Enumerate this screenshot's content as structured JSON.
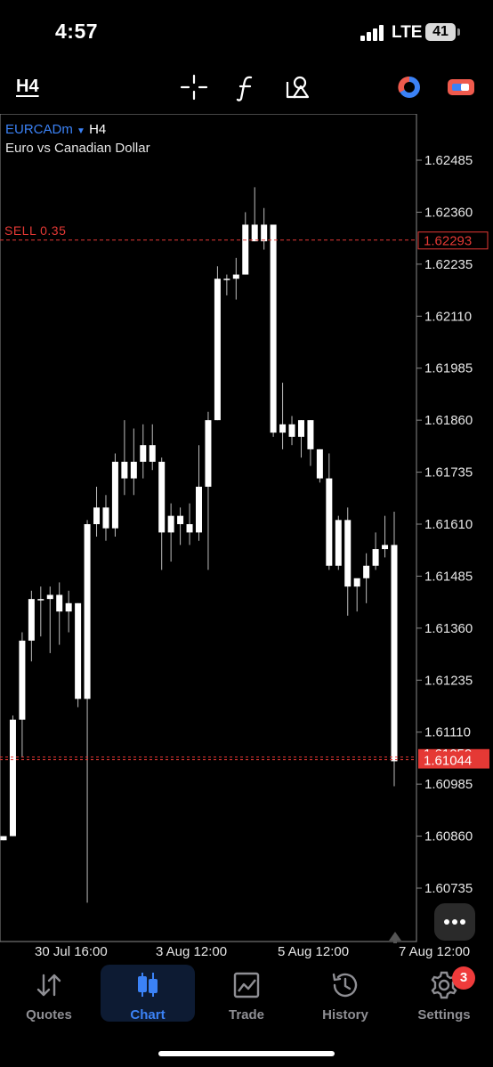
{
  "status": {
    "time": "4:57",
    "network": "LTE",
    "battery": "41"
  },
  "toolbar": {
    "timeframe": "H4"
  },
  "chart": {
    "symbol": "EURCADm",
    "timeframe": "H4",
    "description": "Euro vs Canadian Dollar",
    "sell_label": "SELL 0.35",
    "sell_price": "1.62293",
    "bid_price": "1.61044",
    "ask_price_partial": "1.61050",
    "colors": {
      "accent": "#3b82f6",
      "sell": "#e53935",
      "bid_bg": "#e53935",
      "candle": "#ffffff",
      "background": "#000000"
    }
  },
  "chart_data": {
    "type": "candlestick",
    "y_ticks": [
      "1.62485",
      "1.62360",
      "1.62235",
      "1.62110",
      "1.61985",
      "1.61860",
      "1.61735",
      "1.61610",
      "1.61485",
      "1.61360",
      "1.61235",
      "1.61110",
      "1.60985",
      "1.60860",
      "1.60735"
    ],
    "x_ticks": [
      "30 Jul 16:00",
      "3 Aug 12:00",
      "5 Aug 12:00",
      "7 Aug 12:00"
    ],
    "ylim": [
      1.6068,
      1.6255
    ],
    "candles": [
      [
        1.6085,
        1.6086,
        1.6085,
        1.6086
      ],
      [
        1.6086,
        1.6115,
        1.6086,
        1.6114
      ],
      [
        1.6114,
        1.6135,
        1.6105,
        1.6133
      ],
      [
        1.6133,
        1.6145,
        1.6128,
        1.6143
      ],
      [
        1.6143,
        1.6146,
        1.6134,
        1.6143
      ],
      [
        1.6143,
        1.6146,
        1.613,
        1.6144
      ],
      [
        1.6144,
        1.6147,
        1.6132,
        1.614
      ],
      [
        1.614,
        1.6145,
        1.6135,
        1.6142
      ],
      [
        1.6142,
        1.6142,
        1.6117,
        1.6119
      ],
      [
        1.6119,
        1.6162,
        1.607,
        1.6161
      ],
      [
        1.6161,
        1.617,
        1.6158,
        1.6165
      ],
      [
        1.6165,
        1.6168,
        1.6157,
        1.616
      ],
      [
        1.616,
        1.6178,
        1.6158,
        1.6176
      ],
      [
        1.6176,
        1.6186,
        1.6168,
        1.6172
      ],
      [
        1.6172,
        1.6184,
        1.6168,
        1.6176
      ],
      [
        1.6176,
        1.6185,
        1.6172,
        1.618
      ],
      [
        1.618,
        1.6185,
        1.6174,
        1.6176
      ],
      [
        1.6176,
        1.6177,
        1.615,
        1.6159
      ],
      [
        1.6159,
        1.6166,
        1.6152,
        1.6163
      ],
      [
        1.6163,
        1.6165,
        1.6156,
        1.6161
      ],
      [
        1.6161,
        1.6166,
        1.6156,
        1.6159
      ],
      [
        1.6159,
        1.618,
        1.6157,
        1.617
      ],
      [
        1.617,
        1.6188,
        1.615,
        1.6186
      ],
      [
        1.6186,
        1.6223,
        1.6186,
        1.622
      ],
      [
        1.622,
        1.6221,
        1.6216,
        1.622
      ],
      [
        1.622,
        1.6225,
        1.6215,
        1.6221
      ],
      [
        1.6221,
        1.6236,
        1.6221,
        1.6233
      ],
      [
        1.6233,
        1.6242,
        1.6229,
        1.6229
      ],
      [
        1.6229,
        1.6237,
        1.6227,
        1.6233
      ],
      [
        1.6233,
        1.6233,
        1.6182,
        1.6183
      ],
      [
        1.6183,
        1.6195,
        1.6179,
        1.6185
      ],
      [
        1.6185,
        1.6187,
        1.618,
        1.6182
      ],
      [
        1.6182,
        1.6186,
        1.6177,
        1.6186
      ],
      [
        1.6186,
        1.6186,
        1.6175,
        1.6179
      ],
      [
        1.6179,
        1.6179,
        1.6171,
        1.6172
      ],
      [
        1.6172,
        1.6178,
        1.615,
        1.6151
      ],
      [
        1.6151,
        1.6163,
        1.615,
        1.6162
      ],
      [
        1.6162,
        1.6165,
        1.6139,
        1.6146
      ],
      [
        1.6146,
        1.6147,
        1.614,
        1.6148
      ],
      [
        1.6148,
        1.6154,
        1.6142,
        1.6151
      ],
      [
        1.6151,
        1.6159,
        1.615,
        1.6155
      ],
      [
        1.6155,
        1.6163,
        1.6153,
        1.6156
      ],
      [
        1.6156,
        1.6164,
        1.6098,
        1.6104
      ]
    ]
  },
  "chart_ui": {
    "more_icon": "ellipsis-icon"
  },
  "nav": {
    "items": [
      {
        "label": "Quotes",
        "icon": "sort-arrows-icon"
      },
      {
        "label": "Chart",
        "icon": "candles-icon"
      },
      {
        "label": "Trade",
        "icon": "trend-chart-icon"
      },
      {
        "label": "History",
        "icon": "history-clock-icon"
      },
      {
        "label": "Settings",
        "icon": "gear-icon"
      }
    ],
    "settings_badge": "3"
  }
}
